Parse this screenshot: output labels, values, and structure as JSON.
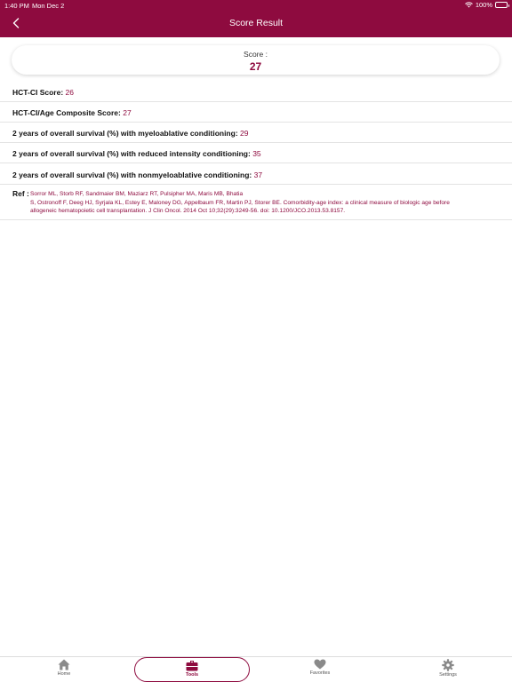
{
  "status_bar": {
    "time": "1:40 PM",
    "date": "Mon Dec 2",
    "battery": "100%"
  },
  "nav": {
    "title": "Score Result"
  },
  "score": {
    "label": "Score :",
    "value": "27"
  },
  "results": [
    {
      "label": "HCT-CI Score:",
      "value": "26"
    },
    {
      "label": "HCT-CI/Age Composite Score:",
      "value": "27"
    },
    {
      "label": "2 years of overall survival (%) with myeloablative conditioning:",
      "value": "29"
    },
    {
      "label": "2 years of overall survival (%) with reduced intensity conditioning:",
      "value": "35"
    },
    {
      "label": "2 years of overall survival (%) with nonmyeloablative conditioning:",
      "value": "37"
    }
  ],
  "reference": {
    "label": "Ref :",
    "line1": "Sorror ML, Storb RF, Sandmaier BM, Maziarz RT, Pulsipher MA, Maris MB, Bhatia",
    "line2": "S, Ostronoff F, Deeg HJ, Syrjala KL, Estey E, Maloney DG, Appelbaum FR, Martin PJ, Storer BE. Comorbidity-age index: a clinical measure of biologic age before",
    "line3": "allogeneic hematopoietic cell transplantation. J Clin Oncol. 2014 Oct 10;32(29):3249-56. doi: 10.1200/JCO.2013.53.8157."
  },
  "tabs": [
    {
      "label": "Home",
      "icon": "home-icon"
    },
    {
      "label": "Tools",
      "icon": "toolbox-icon"
    },
    {
      "label": "Favorites",
      "icon": "heart-icon"
    },
    {
      "label": "Settings",
      "icon": "gear-icon"
    }
  ],
  "colors": {
    "brand": "#8e0b3f",
    "divider": "#e3e3e3",
    "tab_icon": "#8a8a8a"
  }
}
